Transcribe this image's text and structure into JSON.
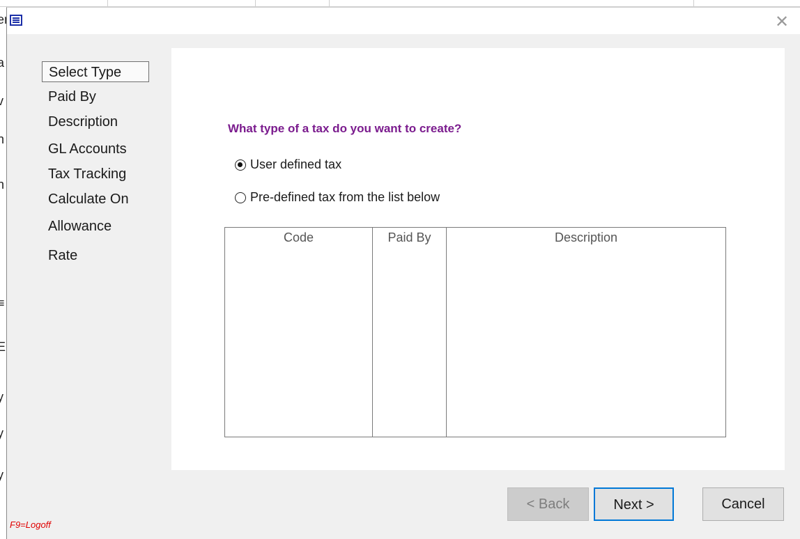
{
  "window": {
    "close_symbol": "✕",
    "icon": "app-icon"
  },
  "steps": [
    {
      "label": "Select Type",
      "active": true
    },
    {
      "label": "Paid By",
      "active": false
    },
    {
      "label": "Description",
      "active": false
    },
    {
      "label": "GL Accounts",
      "active": false
    },
    {
      "label": "Tax Tracking",
      "active": false
    },
    {
      "label": "Calculate On",
      "active": false
    },
    {
      "label": "Allowance",
      "active": false
    },
    {
      "label": "Rate",
      "active": false
    }
  ],
  "question": "What type of a tax do you want to create?",
  "options": [
    {
      "label": "User defined tax",
      "selected": true
    },
    {
      "label": "Pre-defined tax from the list below",
      "selected": false
    }
  ],
  "table": {
    "columns": [
      "Code",
      "Paid By",
      "Description"
    ],
    "rows": []
  },
  "buttons": {
    "back": "< Back",
    "next": "Next >",
    "cancel": "Cancel"
  },
  "hint": "F9=Logoff",
  "colors": {
    "question": "#7b1c8e",
    "hint": "#e00000",
    "focus": "#0078d7"
  }
}
